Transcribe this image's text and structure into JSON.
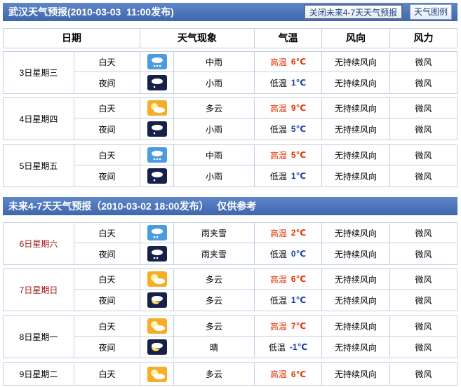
{
  "header": {
    "title": "武汉天气预报(2010-03-03  11:00发布)",
    "buttons": [
      {
        "label": "关闭未来4-7天天气预报",
        "active": true
      },
      {
        "label": "天气图例",
        "active": false
      }
    ]
  },
  "columns": [
    "日期",
    "天气现象",
    "气温",
    "风向",
    "风力"
  ],
  "section2_title": "未来4-7天天气预报（2010-03-02 18:00发布）   仅供参考",
  "temp_labels": {
    "high": "高温",
    "low": "低温"
  },
  "days": [
    {
      "date": "3日星期三",
      "weekend": false,
      "rows": [
        {
          "period": "白天",
          "icon": "moderate-rain-day-icon",
          "weather": "中雨",
          "temp_type": "high",
          "temp": "6℃",
          "wind_dir": "无持续风向",
          "wind_power": "微风"
        },
        {
          "period": "夜间",
          "icon": "light-rain-night-icon",
          "weather": "小雨",
          "temp_type": "low",
          "temp": "1℃",
          "wind_dir": "无持续风向",
          "wind_power": "微风"
        }
      ]
    },
    {
      "date": "4日星期四",
      "weekend": false,
      "rows": [
        {
          "period": "白天",
          "icon": "partly-cloudy-day-icon",
          "weather": "多云",
          "temp_type": "high",
          "temp": "9℃",
          "wind_dir": "无持续风向",
          "wind_power": "微风"
        },
        {
          "period": "夜间",
          "icon": "light-rain-night-icon",
          "weather": "小雨",
          "temp_type": "low",
          "temp": "5℃",
          "wind_dir": "无持续风向",
          "wind_power": "微风"
        }
      ]
    },
    {
      "date": "5日星期五",
      "weekend": false,
      "rows": [
        {
          "period": "白天",
          "icon": "moderate-rain-day-icon",
          "weather": "中雨",
          "temp_type": "high",
          "temp": "5℃",
          "wind_dir": "无持续风向",
          "wind_power": "微风"
        },
        {
          "period": "夜间",
          "icon": "light-rain-night-icon",
          "weather": "小雨",
          "temp_type": "low",
          "temp": "1℃",
          "wind_dir": "无持续风向",
          "wind_power": "微风"
        }
      ]
    },
    {
      "date": "6日星期六",
      "weekend": true,
      "rows": [
        {
          "period": "白天",
          "icon": "sleet-day-icon",
          "weather": "雨夹雪",
          "temp_type": "high",
          "temp": "2℃",
          "wind_dir": "无持续风向",
          "wind_power": "微风"
        },
        {
          "period": "夜间",
          "icon": "sleet-night-icon",
          "weather": "雨夹雪",
          "temp_type": "low",
          "temp": "0℃",
          "wind_dir": "无持续风向",
          "wind_power": "微风"
        }
      ]
    },
    {
      "date": "7日星期日",
      "weekend": true,
      "rows": [
        {
          "period": "白天",
          "icon": "partly-cloudy-day-icon",
          "weather": "多云",
          "temp_type": "high",
          "temp": "6℃",
          "wind_dir": "无持续风向",
          "wind_power": "微风"
        },
        {
          "period": "夜间",
          "icon": "partly-cloudy-night-icon",
          "weather": "多云",
          "temp_type": "low",
          "temp": "1℃",
          "wind_dir": "无持续风向",
          "wind_power": "微风"
        }
      ]
    },
    {
      "date": "8日星期一",
      "weekend": false,
      "rows": [
        {
          "period": "白天",
          "icon": "partly-cloudy-day-icon",
          "weather": "多云",
          "temp_type": "high",
          "temp": "7℃",
          "wind_dir": "无持续风向",
          "wind_power": "微风"
        },
        {
          "period": "夜间",
          "icon": "clear-night-icon",
          "weather": "晴",
          "temp_type": "low",
          "temp": "-1℃",
          "wind_dir": "无持续风向",
          "wind_power": "微风"
        }
      ]
    },
    {
      "date": "9日星期二",
      "weekend": false,
      "rows": [
        {
          "period": "白天",
          "icon": "partly-cloudy-day-icon",
          "weather": "多云",
          "temp_type": "high",
          "temp": "6℃",
          "wind_dir": "无持续风向",
          "wind_power": "微风"
        }
      ]
    }
  ]
}
